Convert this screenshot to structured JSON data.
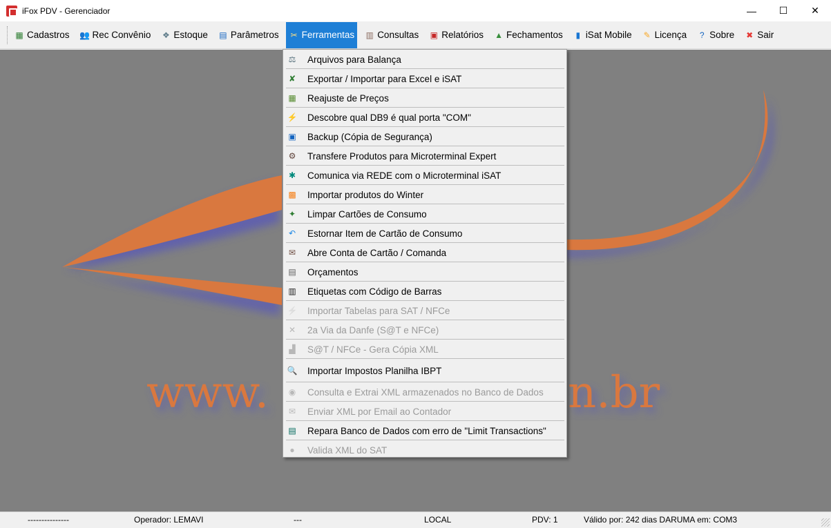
{
  "window": {
    "title": "iFox PDV - Gerenciador",
    "minimize": "—",
    "maximize": "☐",
    "close": "✕"
  },
  "menubar": [
    {
      "label": "Cadastros",
      "icon": "folder-icon",
      "glyph": "▦",
      "color": "#2e7d32"
    },
    {
      "label": "Rec Convênio",
      "icon": "people-icon",
      "glyph": "👥",
      "color": "#5c6bc0"
    },
    {
      "label": "Estoque",
      "icon": "box-icon",
      "glyph": "❖",
      "color": "#607d8b"
    },
    {
      "label": "Parâmetros",
      "icon": "settings-window-icon",
      "glyph": "▤",
      "color": "#1565c0"
    },
    {
      "label": "Ferramentas",
      "icon": "tools-icon",
      "glyph": "✂",
      "color": "#ff9800",
      "active": true
    },
    {
      "label": "Consultas",
      "icon": "books-icon",
      "glyph": "▥",
      "color": "#8d6e63"
    },
    {
      "label": "Relatórios",
      "icon": "report-icon",
      "glyph": "▣",
      "color": "#c62828"
    },
    {
      "label": "Fechamentos",
      "icon": "chart-icon",
      "glyph": "▲",
      "color": "#388e3c"
    },
    {
      "label": "iSat Mobile",
      "icon": "mobile-icon",
      "glyph": "▮",
      "color": "#1976d2"
    },
    {
      "label": "Licença",
      "icon": "key-icon",
      "glyph": "✎",
      "color": "#f9a825"
    },
    {
      "label": "Sobre",
      "icon": "help-icon",
      "glyph": "?",
      "color": "#1565c0"
    },
    {
      "label": "Sair",
      "icon": "exit-icon",
      "glyph": "✖",
      "color": "#e53935"
    }
  ],
  "ferramentas_menu": [
    {
      "label": "Arquivos para Balança",
      "icon": "scale-icon",
      "glyph": "⚖",
      "color": "#546e7a",
      "enabled": true
    },
    {
      "label": "Exportar / Importar para Excel e iSAT",
      "icon": "excel-icon",
      "glyph": "✘",
      "color": "#2e7d32",
      "enabled": true
    },
    {
      "label": "Reajuste de Preços",
      "icon": "calculator-icon",
      "glyph": "▦",
      "color": "#558b2f",
      "enabled": true
    },
    {
      "label": "Descobre qual DB9 é qual porta \"COM\"",
      "icon": "plug-icon",
      "glyph": "⚡",
      "color": "#455a64",
      "enabled": true
    },
    {
      "label": "Backup (Cópia de Segurança)",
      "icon": "disk-icon",
      "glyph": "▣",
      "color": "#1565c0",
      "enabled": true
    },
    {
      "label": "Transfere Produtos para Microterminal Expert",
      "icon": "terminal-icon",
      "glyph": "⚙",
      "color": "#5d4037",
      "enabled": true
    },
    {
      "label": "Comunica via REDE com o Microterminal iSAT",
      "icon": "network-icon",
      "glyph": "✱",
      "color": "#00897b",
      "enabled": true
    },
    {
      "label": "Importar produtos do Winter",
      "icon": "import-icon",
      "glyph": "▩",
      "color": "#f57f17",
      "enabled": true
    },
    {
      "label": "Limpar Cartões de Consumo",
      "icon": "broom-icon",
      "glyph": "✦",
      "color": "#2e7d32",
      "enabled": true
    },
    {
      "label": "Estornar Item de Cartão de Consumo",
      "icon": "undo-icon",
      "glyph": "↶",
      "color": "#1e88e5",
      "enabled": true
    },
    {
      "label": "Abre Conta de Cartão / Comanda",
      "icon": "card-icon",
      "glyph": "✉",
      "color": "#6d4c41",
      "enabled": true
    },
    {
      "label": "Orçamentos",
      "icon": "budget-icon",
      "glyph": "▤",
      "color": "#616161",
      "enabled": true
    },
    {
      "label": "Etiquetas com Código de Barras",
      "icon": "barcode-icon",
      "glyph": "▥",
      "color": "#212121",
      "enabled": true
    },
    {
      "label": "Importar Tabelas para SAT / NFCe",
      "icon": "table-import-icon",
      "glyph": "⚡",
      "color": "#757575",
      "enabled": false
    },
    {
      "label": "2a Via da Danfe (S@T e NFCe)",
      "icon": "scissors-icon",
      "glyph": "✕",
      "color": "#757575",
      "enabled": false
    },
    {
      "label": "S@T / NFCe - Gera Cópia XML",
      "icon": "xml-copy-icon",
      "glyph": "▟",
      "color": "#757575",
      "enabled": false
    },
    {
      "label": "Importar Impostos Planilha IBPT",
      "icon": "magnifier-icon",
      "glyph": "🔍",
      "color": "#1976d2",
      "enabled": true,
      "gap": true
    },
    {
      "label": "Consulta e Extrai XML armazenados no Banco de Dados",
      "icon": "database-search-icon",
      "glyph": "◉",
      "color": "#757575",
      "enabled": false
    },
    {
      "label": "Enviar XML por Email ao Contador",
      "icon": "email-icon",
      "glyph": "✉",
      "color": "#757575",
      "enabled": false
    },
    {
      "label": "Repara Banco de Dados com erro de \"Limit Transactions\"",
      "icon": "database-repair-icon",
      "glyph": "▤",
      "color": "#00695c",
      "enabled": true
    },
    {
      "label": "Valida XML do SAT",
      "icon": "validate-icon",
      "glyph": "●",
      "color": "#757575",
      "enabled": false
    }
  ],
  "statusbar": {
    "field1": "---------------",
    "operator": "Operador: LEMAVI",
    "field3": "---",
    "location": "LOCAL",
    "pdv": "PDV: 1",
    "validity": "Válido por: 242 dias  DARUMA em: COM3"
  },
  "background": {
    "watermark_text": "www.                       n.br",
    "colors": {
      "workspace": "#808080",
      "accent": "#1e7fd6",
      "swoosh": "#e07a3e"
    }
  }
}
